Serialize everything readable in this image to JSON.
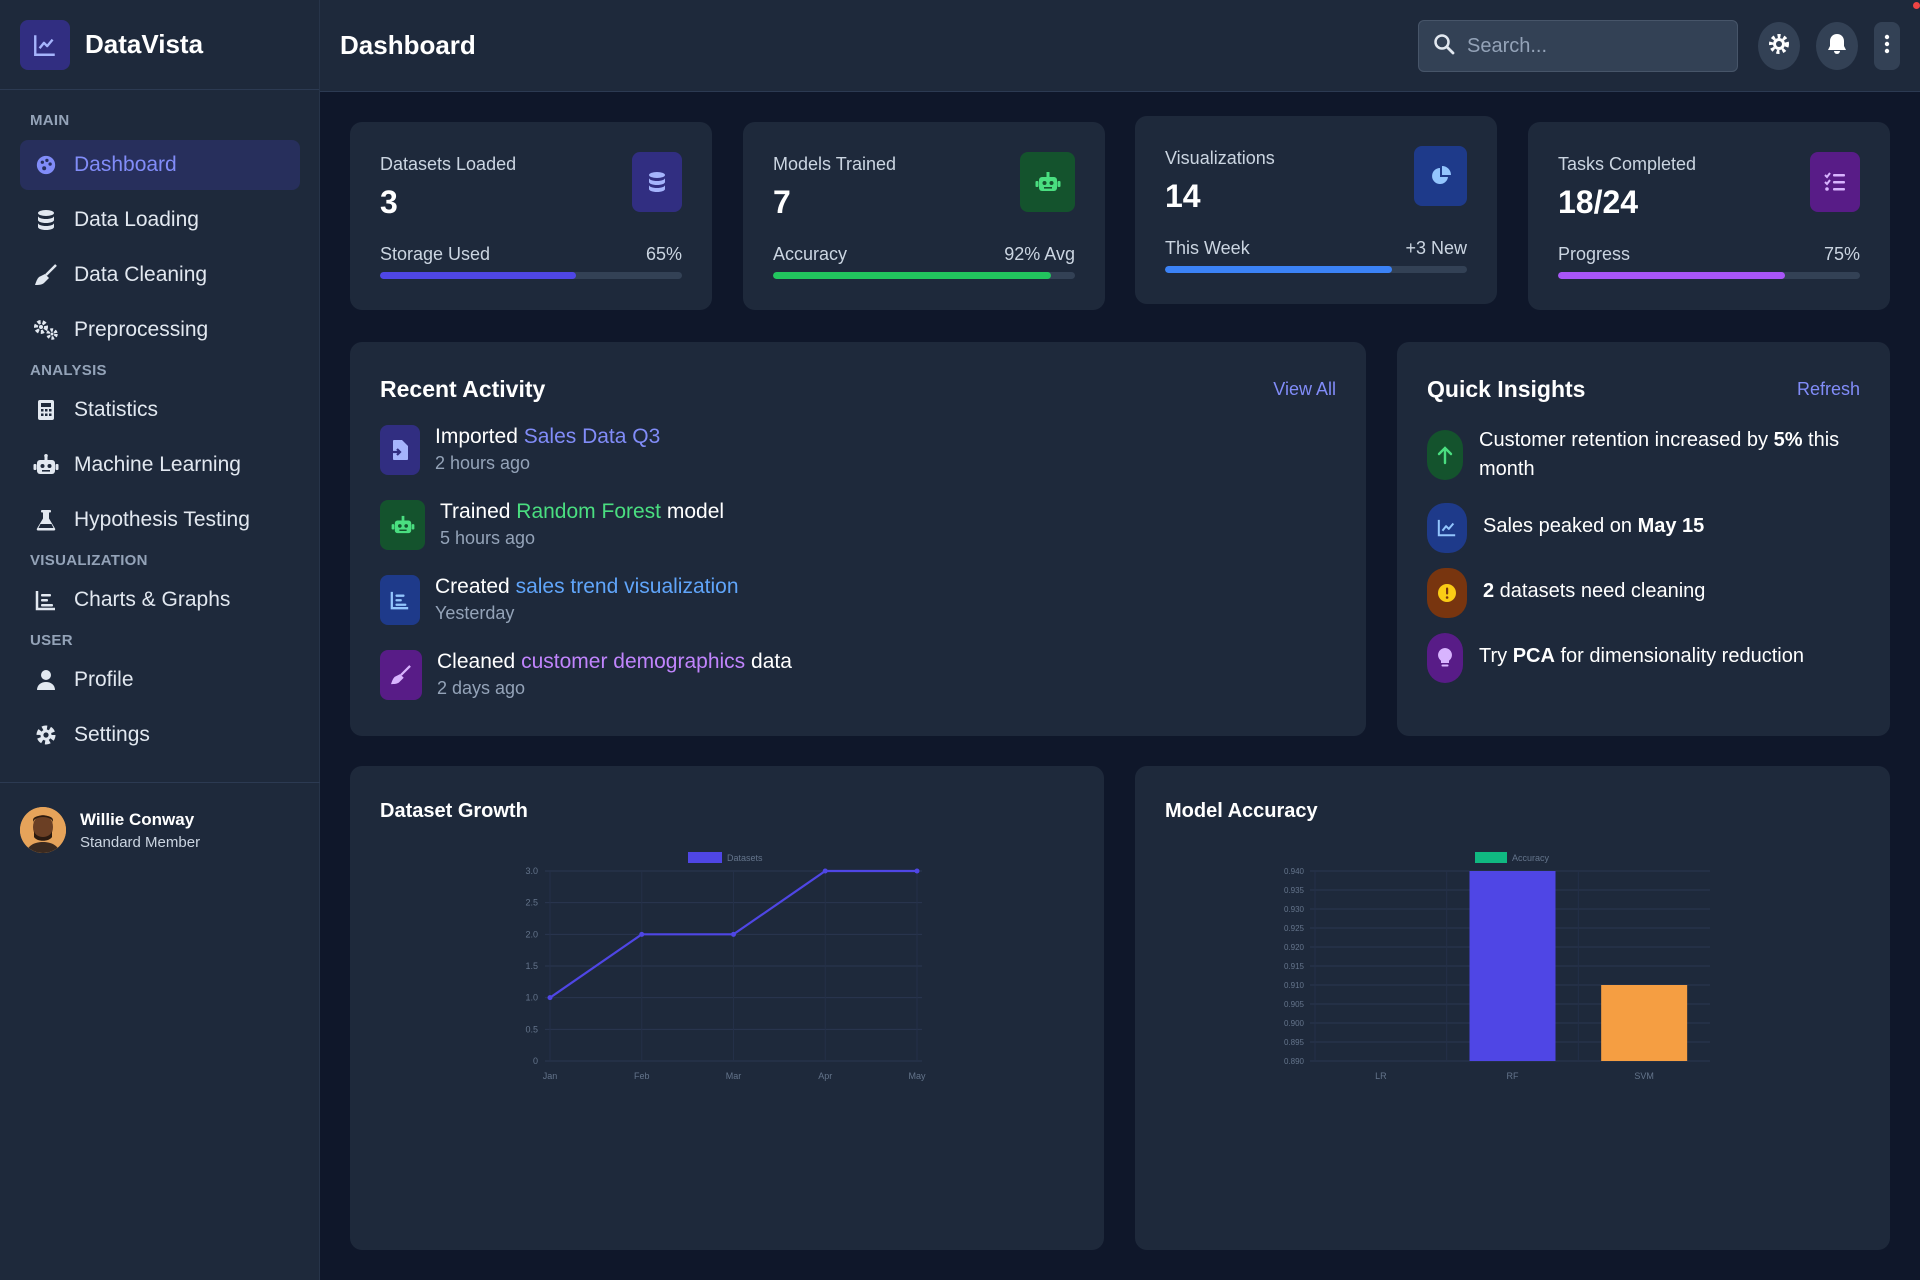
{
  "brand": {
    "name": "DataVista"
  },
  "sidebar": {
    "sections": {
      "main": "MAIN",
      "analysis": "ANALYSIS",
      "visualization": "VISUALIZATION",
      "user": "USER"
    },
    "items": [
      {
        "label": "Dashboard",
        "icon": "palette-icon"
      },
      {
        "label": "Data Loading",
        "icon": "database-icon"
      },
      {
        "label": "Data Cleaning",
        "icon": "broom-icon"
      },
      {
        "label": "Preprocessing",
        "icon": "gears-icon"
      },
      {
        "label": "Statistics",
        "icon": "calculator-icon"
      },
      {
        "label": "Machine Learning",
        "icon": "robot-icon"
      },
      {
        "label": "Hypothesis Testing",
        "icon": "flask-icon"
      },
      {
        "label": "Charts & Graphs",
        "icon": "chart-icon"
      },
      {
        "label": "Profile",
        "icon": "user-icon"
      },
      {
        "label": "Settings",
        "icon": "gear-icon"
      }
    ],
    "user": {
      "name": "Willie Conway",
      "role": "Standard Member"
    }
  },
  "header": {
    "title": "Dashboard",
    "search_placeholder": "Search..."
  },
  "stats": [
    {
      "label": "Datasets Loaded",
      "value": "3",
      "sub": "Storage Used",
      "sub_right": "65%",
      "progress": 0.65,
      "color": "#4f46e5",
      "icon_bg": "#312e81"
    },
    {
      "label": "Models Trained",
      "value": "7",
      "sub": "Accuracy",
      "sub_right": "92% Avg",
      "progress": 0.92,
      "color": "#22c55e",
      "icon_bg": "#14532d"
    },
    {
      "label": "Visualizations",
      "value": "14",
      "sub": "This Week",
      "sub_right": "+3 New",
      "progress": 0.75,
      "color": "#3b82f6",
      "icon_bg": "#1e3a8a"
    },
    {
      "label": "Tasks Completed",
      "value": "18/24",
      "sub": "Progress",
      "sub_right": "75%",
      "progress": 0.75,
      "color": "#a855f7",
      "icon_bg": "#581c87"
    }
  ],
  "activity": {
    "title": "Recent Activity",
    "link": "View All",
    "items": [
      {
        "prefix": "Imported",
        "highlight": "Sales Data Q3",
        "suffix": "",
        "time": "2 hours ago",
        "color": "#818cf8"
      },
      {
        "prefix": "Trained",
        "highlight": "Random Forest",
        "suffix": "model",
        "time": "5 hours ago",
        "color": "#4ade80"
      },
      {
        "prefix": "Created",
        "highlight": "sales trend visualization",
        "suffix": "",
        "time": "Yesterday",
        "color": "#60a5fa"
      },
      {
        "prefix": "Cleaned",
        "highlight": "customer demographics",
        "suffix": "data",
        "time": "2 days ago",
        "color": "#c084fc"
      }
    ]
  },
  "insights": {
    "title": "Quick Insights",
    "link": "Refresh",
    "items": [
      {
        "a": "Customer retention increased by ",
        "b": "5%",
        "c": " this month"
      },
      {
        "a": "Sales peaked on ",
        "b": "May 15",
        "c": ""
      },
      {
        "a": "",
        "b": "2",
        "c": " datasets need cleaning"
      },
      {
        "a": "Try ",
        "b": "PCA",
        "c": " for dimensionality reduction"
      }
    ]
  },
  "charts": {
    "growth_title": "Dataset Growth",
    "accuracy_title": "Model Accuracy"
  },
  "chart_data": [
    {
      "type": "line",
      "title": "Dataset Growth",
      "categories": [
        "Jan",
        "Feb",
        "Mar",
        "Apr",
        "May"
      ],
      "series": [
        {
          "name": "Datasets",
          "values": [
            1,
            2,
            2,
            3,
            3
          ]
        }
      ],
      "ylim": [
        0,
        3
      ],
      "yticks": [
        "0",
        "0.5",
        "1.0",
        "1.5",
        "2.0",
        "2.5",
        "3.0"
      ],
      "color": "#4f46e5",
      "legend": "top"
    },
    {
      "type": "bar",
      "title": "Model Accuracy",
      "categories": [
        "LR",
        "RF",
        "SVM"
      ],
      "series": [
        {
          "name": "Accuracy",
          "values": [
            0.89,
            0.94,
            0.91
          ]
        }
      ],
      "ylim": [
        0.89,
        0.94
      ],
      "yticks": [
        "0.890",
        "0.895",
        "0.900",
        "0.905",
        "0.910",
        "0.915",
        "0.920",
        "0.925",
        "0.930",
        "0.935",
        "0.940"
      ],
      "colors": [
        "#10b981",
        "#4f46e5",
        "#f59e42"
      ],
      "legend": "top"
    }
  ]
}
